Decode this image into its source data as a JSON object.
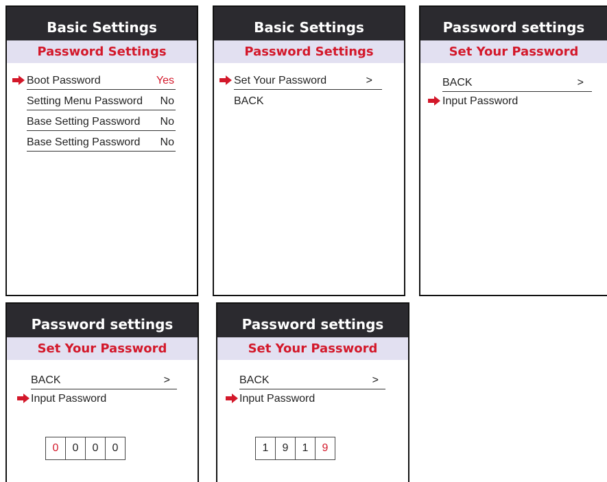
{
  "colors": {
    "header_bg": "#2b2a2f",
    "subheader_bg": "#e2e0f1",
    "accent_red": "#d3182a"
  },
  "screen1": {
    "title": "Basic Settings",
    "subtitle": "Password Settings",
    "items": [
      {
        "label": "Boot Password",
        "value": "Yes"
      },
      {
        "label": "Setting Menu Password",
        "value": "No"
      },
      {
        "label": "Base Setting Password",
        "value": "No"
      },
      {
        "label": "Base Setting Password",
        "value": "No"
      }
    ]
  },
  "screen2": {
    "title": "Basic Settings",
    "subtitle": "Password Settings",
    "items": [
      {
        "label": "Set Your Password",
        "value": ">"
      },
      {
        "label": "BACK",
        "value": ""
      }
    ]
  },
  "screen3": {
    "title": "Password settings",
    "subtitle": "Set Your Password",
    "items": [
      {
        "label": "BACK",
        "value": ">"
      },
      {
        "label": "Input Password",
        "value": ""
      }
    ]
  },
  "screen4": {
    "title": "Password settings",
    "subtitle": "Set Your Password",
    "items": [
      {
        "label": "BACK",
        "value": ">"
      },
      {
        "label": "Input Password",
        "value": ""
      }
    ],
    "digits": [
      "0",
      "0",
      "0",
      "0"
    ],
    "active_digit": 1
  },
  "screen5": {
    "title": "Password settings",
    "subtitle": "Set Your Password",
    "items": [
      {
        "label": "BACK",
        "value": ">"
      },
      {
        "label": "Input Password",
        "value": ""
      }
    ],
    "digits": [
      "1",
      "9",
      "1",
      "9"
    ],
    "active_digit": 4
  }
}
